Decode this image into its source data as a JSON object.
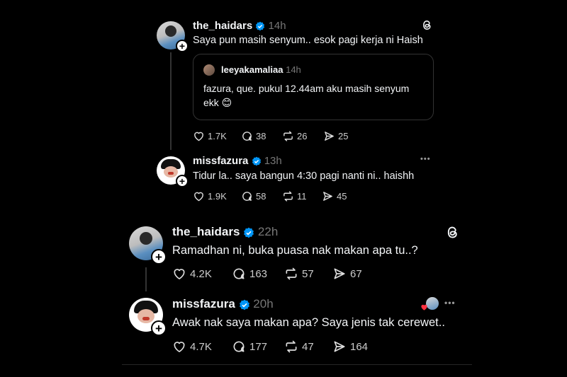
{
  "colors": {
    "background": "#000000",
    "text": "#f3f5f7",
    "muted": "#777777",
    "verified": "#0095f6",
    "line": "#333333"
  },
  "post1": {
    "username": "the_haidars",
    "time": "14h",
    "text": "Saya pun masih senyum.. esok pagi kerja ni Haish",
    "quote": {
      "username": "leeyakamaliaa",
      "time": "14h",
      "text_line1": "fazura, que. pukul 12.44am aku masih senyum",
      "text_line2": "ekk 😊"
    },
    "likes": "1.7K",
    "replies": "38",
    "reposts": "26",
    "shares": "25",
    "icon": "threads-logo-icon"
  },
  "post2": {
    "username": "missfazura",
    "time": "13h",
    "text": "Tidur la.. saya bangun 4:30 pagi nanti ni.. haishh",
    "likes": "1.9K",
    "replies": "58",
    "reposts": "11",
    "shares": "45",
    "more": "•••"
  },
  "post3": {
    "username": "the_haidars",
    "time": "22h",
    "text": "Ramadhan ni, buka puasa nak makan apa tu..?",
    "likes": "4.2K",
    "replies": "163",
    "reposts": "57",
    "shares": "67",
    "icon": "threads-logo-icon"
  },
  "post4": {
    "username": "missfazura",
    "time": "20h",
    "text": "Awak nak saya makan apa? Saya jenis tak cerewet..",
    "likes": "4.7K",
    "replies": "177",
    "reposts": "47",
    "shares": "164",
    "more": "•••"
  }
}
